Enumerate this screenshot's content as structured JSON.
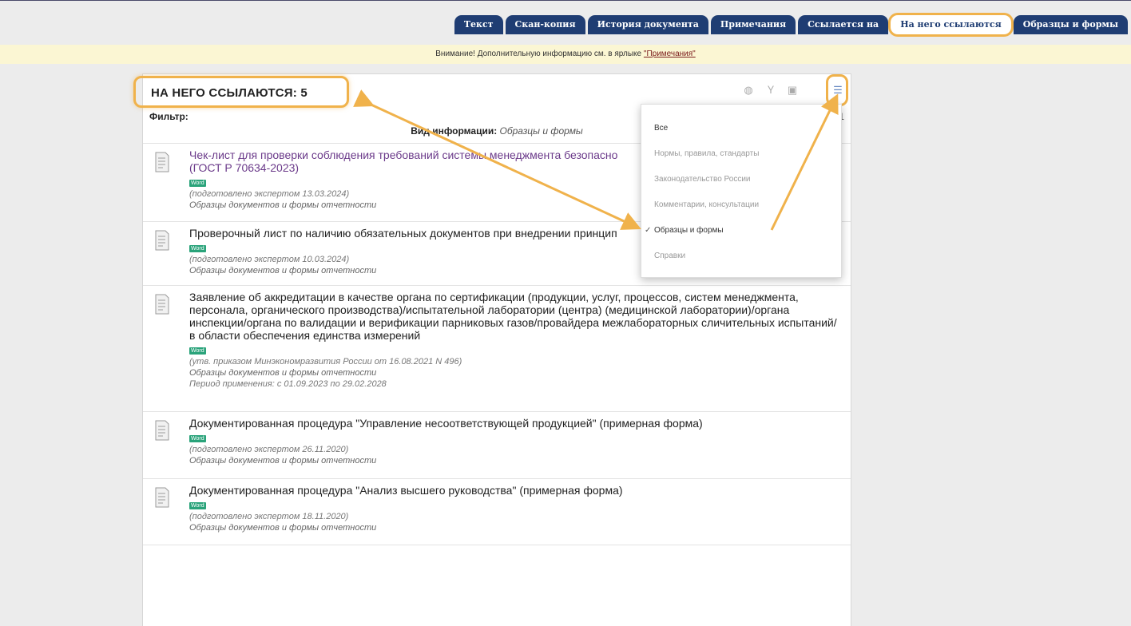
{
  "tabs": [
    {
      "label": "Текст",
      "active": false
    },
    {
      "label": "Скан-копия",
      "active": false
    },
    {
      "label": "История документа",
      "active": false
    },
    {
      "label": "Примечания",
      "active": false
    },
    {
      "label": "Ссылается на",
      "active": false
    },
    {
      "label": "На него ссылаются",
      "active": true
    },
    {
      "label": "Образцы и формы",
      "active": false
    }
  ],
  "notice": {
    "prefix": "Внимание! Дополнительную информацию см. в ярлыке",
    "link": "\"Примечания\""
  },
  "panel": {
    "title": "НА НЕГО ССЫЛАЮТСЯ: 5",
    "filter_label": "Фильтр:",
    "filter_more": "1",
    "info_label": "Вид информации:",
    "info_value": "Образцы и формы"
  },
  "items": [
    {
      "title": "Чек-лист для проверки соблюдения требований системы менеджмента безопасно",
      "title2": "(ГОСТ Р 70634-2023)",
      "badge": "Word",
      "meta1": "(подготовлено экспертом 13.03.2024)",
      "meta2": "Образцы документов и формы отчетности"
    },
    {
      "title": "Проверочный лист по наличию обязательных документов при внедрении принцип",
      "badge": "Word",
      "meta1": "(подготовлено экспертом 10.03.2024)",
      "meta2": "Образцы документов и формы отчетности"
    },
    {
      "title": "Заявление об аккредитации в качестве органа по сертификации (продукции, услуг, процессов, систем менеджмента, персонала, органического производства)/испытательной лаборатории (центра) (медицинской лаборатории)/органа инспекции/органа по валидации и верификации парниковых газов/провайдера межлабораторных сличительных испытаний/в области обеспечения единства измерений",
      "badge": "Word",
      "meta1": "(утв. приказом Минэкономразвития России от 16.08.2021 N 496)",
      "meta2": "Образцы документов и формы отчетности",
      "meta3": "Период применения: с 01.09.2023 по 29.02.2028"
    },
    {
      "title": "Документированная процедура \"Управление несоответствующей продукцией\" (примерная форма)",
      "badge": "Word",
      "meta1": "(подготовлено экспертом 26.11.2020)",
      "meta2": "Образцы документов и формы отчетности"
    },
    {
      "title": "Документированная процедура \"Анализ высшего руководства\" (примерная форма)",
      "badge": "Word",
      "meta1": "(подготовлено экспертом 18.11.2020)",
      "meta2": "Образцы документов и формы отчетности"
    }
  ],
  "dropdown": {
    "items": [
      "Все",
      "Нормы, правила, стандарты",
      "Законодательство России",
      "Комментарии, консультации",
      "Образцы и формы",
      "Справки"
    ],
    "selected_index": 4,
    "check": "✓"
  },
  "colors": {
    "tab_bg": "#1f3d73",
    "highlight": "#f0b24b",
    "notice_bg": "#fbf6d3",
    "word_badge": "#2aa37a"
  }
}
